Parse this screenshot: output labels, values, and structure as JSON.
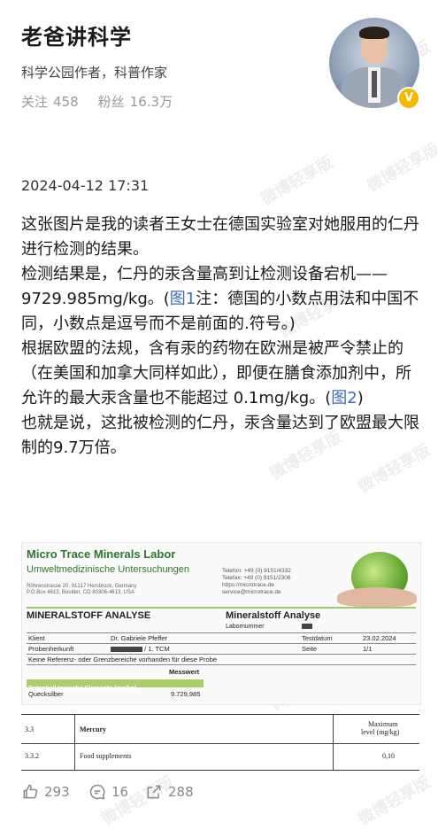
{
  "profile": {
    "name": "老爸讲科学",
    "bio": "科学公园作者，科普作家",
    "following_label": "关注",
    "following_count": "458",
    "followers_label": "粉丝",
    "followers_count": "16.3万",
    "verified_badge": "V"
  },
  "watermark_text": "微博轻享版",
  "post": {
    "datetime": "2024-04-12 17:31",
    "p1": "这张图片是我的读者王女士在德国实验室对她服用的仁丹进行检测的结果。",
    "p2_a": "检测结果是，仁丹的汞含量高到让检测设备宕机——9729.985mg/kg。(",
    "p2_link": "图1",
    "p2_b": "注：德国的小数点用法和中国不同，小数点是逗号而不是前面的.符号。)",
    "p3_a": "根据欧盟的法规，含有汞的药物在欧洲是被严令禁止的（在美国和加拿大同样如此），即便在膳食添加剂中，所允许的最大汞含量也不能超过 0.1mg/kg。(",
    "p3_link": "图2",
    "p3_b": ")",
    "p4": "也就是说，这批被检测的仁丹，汞含量达到了欧盟最大限制的9.7万倍。"
  },
  "image1": {
    "lab_name": "Micro Trace Minerals Labor",
    "lab_sub": "Umweltmedizinische Untersuchungen",
    "address_1": "Röhrenstrasse 20, 91217 Hersbruck, Germany",
    "address_2": "P.O.Box 4613, Boulder, CO 80306-4613, USA",
    "tel": "Telefon:    +49 (0) 9151/4332",
    "fax": "Telefax:    +49 (0) 9151/2306",
    "web": "https://microtrace.de",
    "email": "service@microtrace.de",
    "title_left": "MINERALSTOFF ANALYSE",
    "title_right": "Mineralstoff Analyse",
    "labnummer": "Labornummer",
    "klient_label": "Klient",
    "klient_value": "Dr. Gabriele Pfeffer",
    "testdatum_label": "Testdatum",
    "testdatum_value": "23.02.2024",
    "probe_label": "Probenherkunft",
    "probe_value": "/ 1. TCM",
    "seite_label": "Seite",
    "seite_value": "1/1",
    "note": "Keine Referenz- oder Grenzbereiche vorhanden für diese Probe",
    "messwert": "Messwert",
    "toxic_header": "Potentiell toxische Elemente (mg/kg)",
    "element": "Quecksilber",
    "value": "9.729,985"
  },
  "image2": {
    "sec": "3.3",
    "category": "Mercury",
    "max_label_1": "Maximum",
    "max_label_2": "level (mg/kg)",
    "sub": "3.3.2",
    "item": "Food supplements",
    "limit": "0,10"
  },
  "actions": {
    "likes": "293",
    "comments": "16",
    "reposts": "288"
  }
}
